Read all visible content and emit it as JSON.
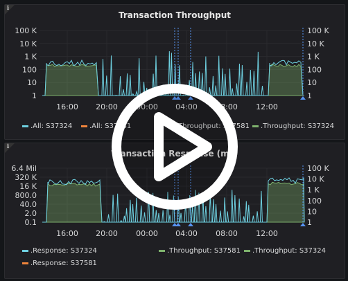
{
  "panels": [
    {
      "title": "Transaction Throughput",
      "info_glyph": "i",
      "chart_data": {
        "type": "line",
        "left_axis_ticks": [
          "100 K",
          "10 K",
          "1 K",
          "100",
          "10",
          "1"
        ],
        "right_axis_ticks": [
          "100 K",
          "10 K",
          "1 K",
          "100",
          "10",
          "1"
        ],
        "x_ticks": [
          "16:00",
          "20:00",
          "00:00",
          "04:00",
          "08:00",
          "12:00"
        ],
        "log_scale": true,
        "series": [
          {
            "name": ".All: S37324",
            "color": "#6ed0e0"
          },
          {
            "name": ".All: S37581",
            "color": "#ef843c"
          },
          {
            "name": ".Throughput: S37581",
            "color": "#7eb26d"
          },
          {
            "name": ".Throughput: S37324",
            "color": "#7eb26d"
          }
        ]
      },
      "legend": [
        ".All: S37324",
        ".All: S37581",
        ".Throughput: S37581",
        ".Throughput: S37324"
      ]
    },
    {
      "title": "Transaction Response (ms)",
      "info_glyph": "i",
      "chart_data": {
        "type": "line",
        "left_axis_ticks": [
          "6.4 Mil",
          "320 K",
          "16 K",
          "800.0",
          "40.0",
          "2.0",
          "0.1"
        ],
        "right_axis_ticks": [
          "100 K",
          "10 K",
          "1 K",
          "100",
          "10",
          "1"
        ],
        "x_ticks": [
          "16:00",
          "20:00",
          "00:00",
          "04:00",
          "08:00",
          "12:00"
        ],
        "log_scale": true,
        "series": [
          {
            "name": ".Response: S37324",
            "color": "#6ed0e0"
          },
          {
            "name": ".Throughput: S37581",
            "color": "#7eb26d"
          },
          {
            "name": ".Throughput: S37324",
            "color": "#7eb26d"
          },
          {
            "name": ".Response: S37581",
            "color": "#ef843c"
          }
        ]
      },
      "legend": [
        ".Response: S37324",
        ".Throughput: S37581",
        ".Throughput: S37324",
        ".Response: S37581"
      ]
    }
  ],
  "colors": {
    "cyan": "#6ed0e0",
    "orange": "#ef843c",
    "green": "#7eb26d",
    "annotation": "#5794f2"
  },
  "overlay": {
    "icon": "play-icon"
  }
}
